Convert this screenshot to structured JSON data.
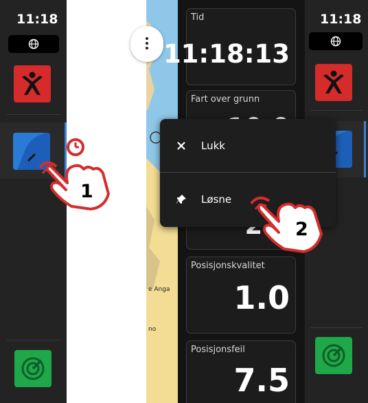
{
  "left_panel": {
    "time": "11:18",
    "step_number": "1"
  },
  "map": {
    "place_label_1": "e Anga",
    "place_label_2": "no"
  },
  "data_cards": [
    {
      "label": "Tid",
      "value": "11:18:13"
    },
    {
      "label": "Fart over grunn",
      "value": "10.0"
    },
    {
      "label": "",
      "value": "2.9"
    },
    {
      "label": "Posisjonskvalitet",
      "value": "1.0"
    },
    {
      "label": "Posisjonsfeil",
      "value": "7.5"
    }
  ],
  "context_menu": {
    "close_label": "Lukk",
    "unpin_label": "Løsne"
  },
  "right_panel": {
    "time": "11:18",
    "step_number": "2"
  },
  "colors": {
    "panel_bg": "#232323",
    "red_button": "#d52b2b",
    "green_button": "#1fa84a",
    "chart_blue": "#2a7bd6",
    "accent_red": "#d32d2d"
  }
}
